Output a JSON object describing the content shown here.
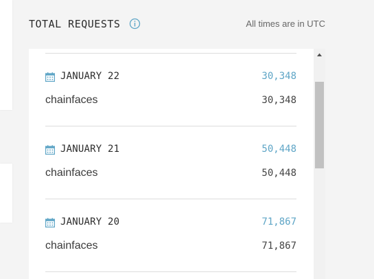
{
  "header": {
    "title": "TOTAL REQUESTS",
    "timezone_note": "All times are in UTC"
  },
  "colors": {
    "accent": "#5ea5c6",
    "background": "#f4f4f4",
    "card": "#ffffff"
  },
  "icons": {
    "info": "info-icon",
    "calendar": "calendar-icon",
    "scroll_up": "chevron-up-icon"
  },
  "days": [
    {
      "date": "JANUARY 22",
      "total": "30,348",
      "projects": [
        {
          "name": "chainfaces",
          "count": "30,348"
        }
      ]
    },
    {
      "date": "JANUARY 21",
      "total": "50,448",
      "projects": [
        {
          "name": "chainfaces",
          "count": "50,448"
        }
      ]
    },
    {
      "date": "JANUARY 20",
      "total": "71,867",
      "projects": [
        {
          "name": "chainfaces",
          "count": "71,867"
        }
      ]
    }
  ]
}
